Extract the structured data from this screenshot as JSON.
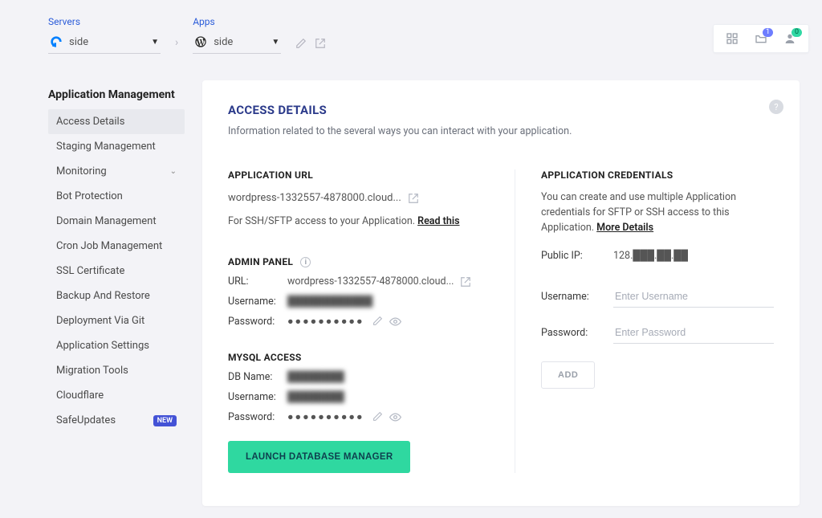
{
  "context": {
    "servers_label": "Servers",
    "server_name": "side",
    "apps_label": "Apps",
    "app_name": "side"
  },
  "toolbar": {
    "projects_badge": "1",
    "users_badge": "0"
  },
  "sidebar": {
    "title": "Application Management",
    "items": [
      {
        "label": "Access Details",
        "active": true
      },
      {
        "label": "Staging Management"
      },
      {
        "label": "Monitoring",
        "expandable": true
      },
      {
        "label": "Bot Protection"
      },
      {
        "label": "Domain Management"
      },
      {
        "label": "Cron Job Management"
      },
      {
        "label": "SSL Certificate"
      },
      {
        "label": "Backup And Restore"
      },
      {
        "label": "Deployment Via Git"
      },
      {
        "label": "Application Settings"
      },
      {
        "label": "Migration Tools"
      },
      {
        "label": "Cloudflare"
      },
      {
        "label": "SafeUpdates",
        "new": true
      }
    ],
    "new_badge_text": "NEW"
  },
  "main": {
    "heading": "ACCESS DETAILS",
    "subheading": "Information related to the several ways you can interact with your application.",
    "app_url_title": "APPLICATION URL",
    "app_url_value": "wordpress-1332557-4878000.cloud...",
    "app_url_hint_prefix": "For SSH/SFTP access to your Application. ",
    "app_url_hint_link": "Read this",
    "admin_title": "ADMIN PANEL",
    "admin_url_key": "URL:",
    "admin_url_value": "wordpress-1332557-4878000.cloud...",
    "username_key": "Username:",
    "password_key": "Password:",
    "admin_username_blur": "████████████",
    "admin_password_dots": "●●●●●●●●●●",
    "mysql_title": "MYSQL ACCESS",
    "db_name_key": "DB Name:",
    "db_name_blur": "████████",
    "mysql_user_blur": "████████",
    "mysql_password_dots": "●●●●●●●●●●",
    "launch_btn": "LAUNCH DATABASE MANAGER",
    "cred_title": "APPLICATION CREDENTIALS",
    "cred_text_prefix": "You can create and use multiple Application credentials for SFTP or SSH access to this Application. ",
    "cred_text_link": "More Details",
    "public_ip_key": "Public IP:",
    "public_ip_value": "128.███.██.██",
    "cred_user_key": "Username:",
    "cred_pass_key": "Password:",
    "cred_user_placeholder": "Enter Username",
    "cred_pass_placeholder": "Enter Password",
    "add_btn": "ADD"
  }
}
